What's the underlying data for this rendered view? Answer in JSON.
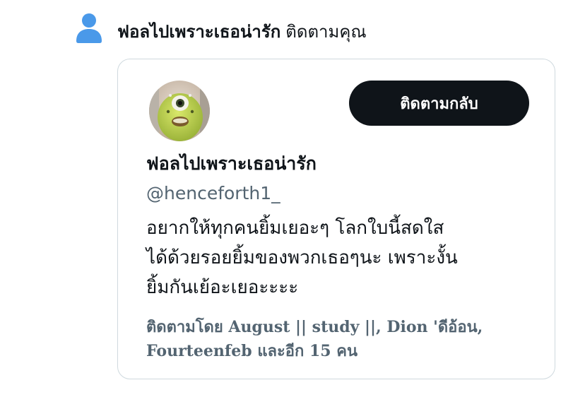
{
  "notification": {
    "icon": "person-icon",
    "icon_color": "#4a99e9",
    "name": "ฟอลไปเพราะเธอน่ารัก",
    "action": "ติดตามคุณ"
  },
  "card": {
    "avatar": "avatar",
    "follow_back_label": "ติดตามกลับ",
    "name": "ฟอลไปเพราะเธอน่ารัก",
    "handle": "@henceforth1_",
    "bio_lines": [
      "อยากให้ทุกคนยิ้มเยอะๆ โลกใบนี้สดใส",
      "ได้ด้วยรอยยิ้มของพวกเธอๆนะ เพราะงั้น",
      "ยิ้มกันเย้อะเยอะะะะ"
    ],
    "followed_by_lines": [
      "ติดตามโดย August || study ||, Dion 'ดีอ้อน,",
      "Fourteenfeb และอีก 15 คน"
    ]
  },
  "colors": {
    "text_primary": "#0f1419",
    "text_secondary": "#536471",
    "button_bg": "#0f1419",
    "button_text": "#ffffff",
    "card_border": "#cfd9de"
  }
}
